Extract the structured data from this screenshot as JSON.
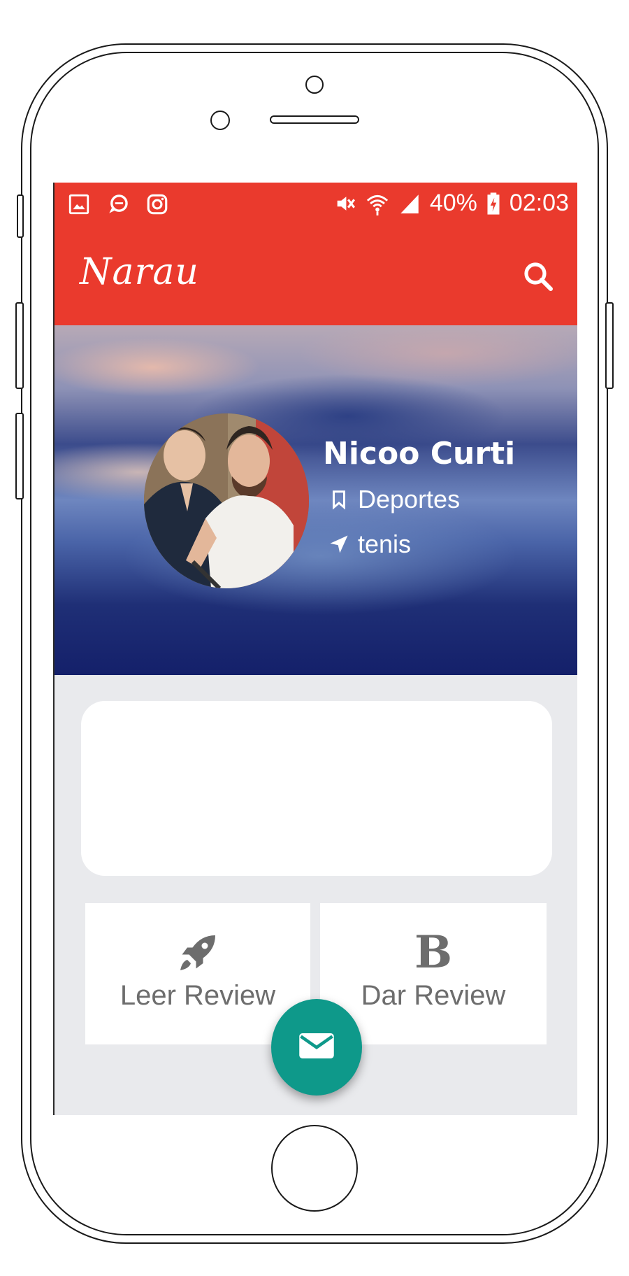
{
  "status_bar": {
    "battery": "40%",
    "time": "02:03",
    "left_icons": [
      "image-icon",
      "chat-icon",
      "instagram-icon"
    ],
    "right_icons": [
      "mute-icon",
      "wifi-icon",
      "signal-icon",
      "battery-charging-icon"
    ]
  },
  "app_bar": {
    "logo": "Narau",
    "search_icon": "search-icon",
    "color": "#ea3a2d"
  },
  "profile": {
    "name": "Nicoo Curti",
    "category": "Deportes",
    "category_icon": "bookmark-icon",
    "tag": "tenis",
    "tag_icon": "navigation-arrow-icon"
  },
  "actions": {
    "read_review": {
      "label": "Leer Review",
      "icon": "rocket-icon"
    },
    "give_review": {
      "label": "Dar Review",
      "icon": "bold-b-icon",
      "glyph": "B"
    }
  },
  "fab": {
    "icon": "mail-icon",
    "color": "#0e998a"
  }
}
